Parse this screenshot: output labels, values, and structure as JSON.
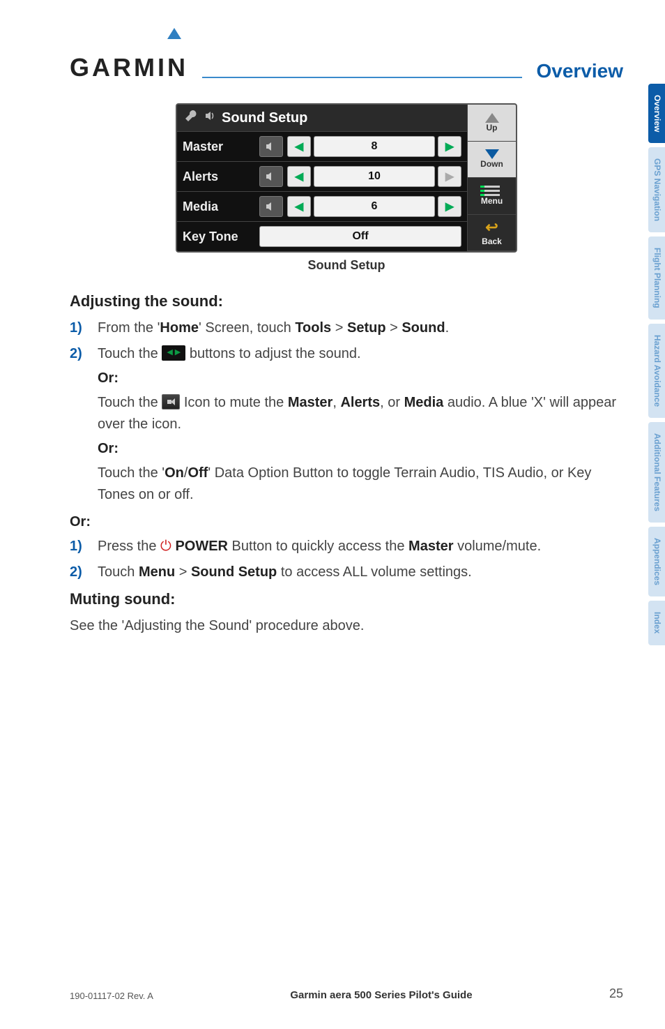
{
  "header": {
    "brand": "GARMIN",
    "section": "Overview"
  },
  "screenshot": {
    "title": "Sound Setup",
    "rows": {
      "master": {
        "label": "Master",
        "value": "8"
      },
      "alerts": {
        "label": "Alerts",
        "value": "10"
      },
      "media": {
        "label": "Media",
        "value": "6"
      },
      "keytone": {
        "label": "Key Tone",
        "value": "Off"
      }
    },
    "side": {
      "up": "Up",
      "down": "Down",
      "menu": "Menu",
      "back": "Back"
    },
    "caption": "Sound Setup"
  },
  "sections": {
    "adjusting_heading": "Adjusting the sound:",
    "muting_heading": "Muting sound:",
    "muting_text": "See the 'Adjusting the Sound' procedure above."
  },
  "steps1": {
    "s1_pre": "From the '",
    "s1_home": "Home",
    "s1_mid": "' Screen, touch ",
    "s1_tools": "Tools",
    "s1_setup": "Setup",
    "s1_sound": "Sound",
    "s2_pre": "Touch the ",
    "s2_post": " buttons to adjust the sound.",
    "or": "Or",
    "s2_alt1_pre": "Touch the ",
    "s2_alt1_mid": " Icon to mute the ",
    "s2_alt1_master": "Master",
    "s2_alt1_alerts": "Alerts",
    "s2_alt1_media": "Media",
    "s2_alt1_post": " audio.  A blue 'X' will appear over the icon.",
    "s2_alt2_pre": "Touch the '",
    "s2_alt2_on": "On",
    "s2_alt2_off": "Off",
    "s2_alt2_post": "' Data Option Button to toggle Terrain Audio, TIS Audio, or Key Tones on or off."
  },
  "or_main": "Or:",
  "steps2": {
    "s1_pre": "Press the ",
    "s1_power": "POWER",
    "s1_mid": " Button to quickly access the ",
    "s1_master": "Master",
    "s1_post": " volume/mute.",
    "s2_pre": "Touch ",
    "s2_menu": "Menu",
    "s2_sound": "Sound Setup",
    "s2_post": " to access ALL volume settings."
  },
  "tabs": {
    "t1": "Overview",
    "t2": "GPS Navigation",
    "t3": "Flight Planning",
    "t4": "Hazard Avoidance",
    "t5": "Additional Features",
    "t6": "Appendices",
    "t7": "Index"
  },
  "footer": {
    "left": "190-01117-02 Rev. A",
    "center": "Garmin aera 500 Series Pilot's Guide",
    "page": "25"
  },
  "labels": {
    "step1": "1)",
    "step2": "2)"
  }
}
